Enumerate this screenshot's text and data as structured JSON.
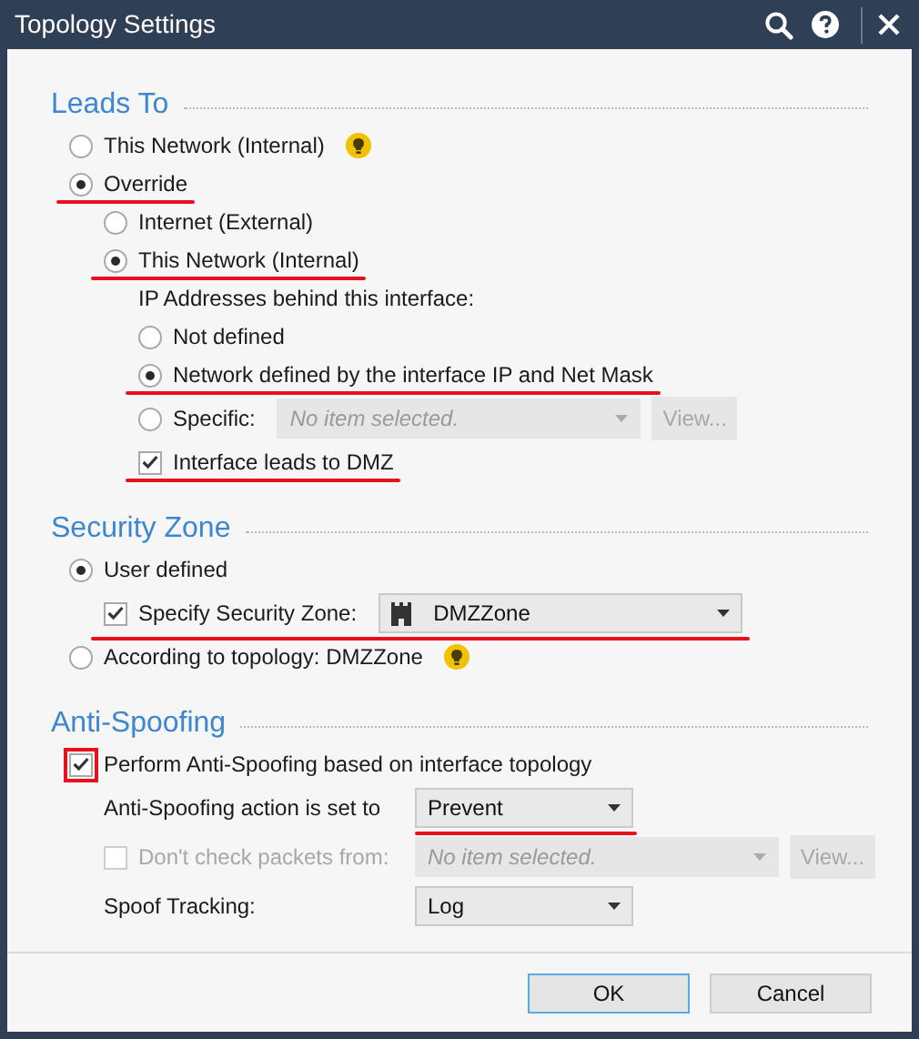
{
  "window": {
    "title": "Topology Settings"
  },
  "sections": [
    {
      "title": "Leads To",
      "rows": [
        {
          "kind": "radio",
          "label": "This Network (Internal)",
          "selected": false,
          "tip_icon": true
        },
        {
          "kind": "radio",
          "label": "Override",
          "selected": true,
          "underlined": true,
          "children": [
            {
              "kind": "radio",
              "label": "Internet (External)",
              "selected": false
            },
            {
              "kind": "radio",
              "label": "This Network (Internal)",
              "selected": true,
              "underlined": true,
              "children": [
                {
                  "kind": "label",
                  "label": "IP Addresses behind this interface:"
                },
                {
                  "kind": "radio",
                  "label": "Not defined",
                  "selected": false
                },
                {
                  "kind": "radio",
                  "label": "Network defined by the interface IP and Net Mask",
                  "selected": true,
                  "underlined": true
                },
                {
                  "kind": "radio",
                  "label": "Specific:",
                  "selected": false,
                  "combo": {
                    "placeholder": "No item selected.",
                    "disabled": true
                  },
                  "button": {
                    "label": "View...",
                    "disabled": true
                  }
                },
                {
                  "kind": "checkbox",
                  "label": "Interface leads to DMZ",
                  "checked": true,
                  "underlined": true
                }
              ]
            }
          ]
        }
      ]
    },
    {
      "title": "Security Zone",
      "rows": [
        {
          "kind": "radio",
          "label": "User defined",
          "selected": true,
          "children": [
            {
              "kind": "checkbox",
              "label": "Specify Security Zone:",
              "checked": true,
              "underlined": true,
              "combo": {
                "value": "DMZZone",
                "zone_icon": true,
                "disabled": false
              }
            }
          ]
        },
        {
          "kind": "radio",
          "label": "According to topology: DMZZone",
          "selected": false,
          "tip_icon": true
        }
      ]
    },
    {
      "title": "Anti-Spoofing",
      "rows": [
        {
          "kind": "checkbox",
          "label": "Perform Anti-Spoofing based on interface topology",
          "checked": true,
          "boxed": true,
          "children": [
            {
              "kind": "field",
              "label": "Anti-Spoofing action is set to",
              "combo": {
                "value": "Prevent",
                "disabled": false,
                "underlined": true
              }
            },
            {
              "kind": "checkbox",
              "label": "Don't check packets from:",
              "checked": false,
              "disabled": true,
              "combo": {
                "placeholder": "No item selected.",
                "disabled": true
              },
              "button": {
                "label": "View...",
                "disabled": true
              }
            },
            {
              "kind": "field",
              "label": "Spoof Tracking:",
              "combo": {
                "value": "Log",
                "disabled": false
              }
            }
          ]
        }
      ]
    }
  ],
  "buttons": [
    {
      "label": "OK",
      "default": true
    },
    {
      "label": "Cancel",
      "default": false
    }
  ]
}
